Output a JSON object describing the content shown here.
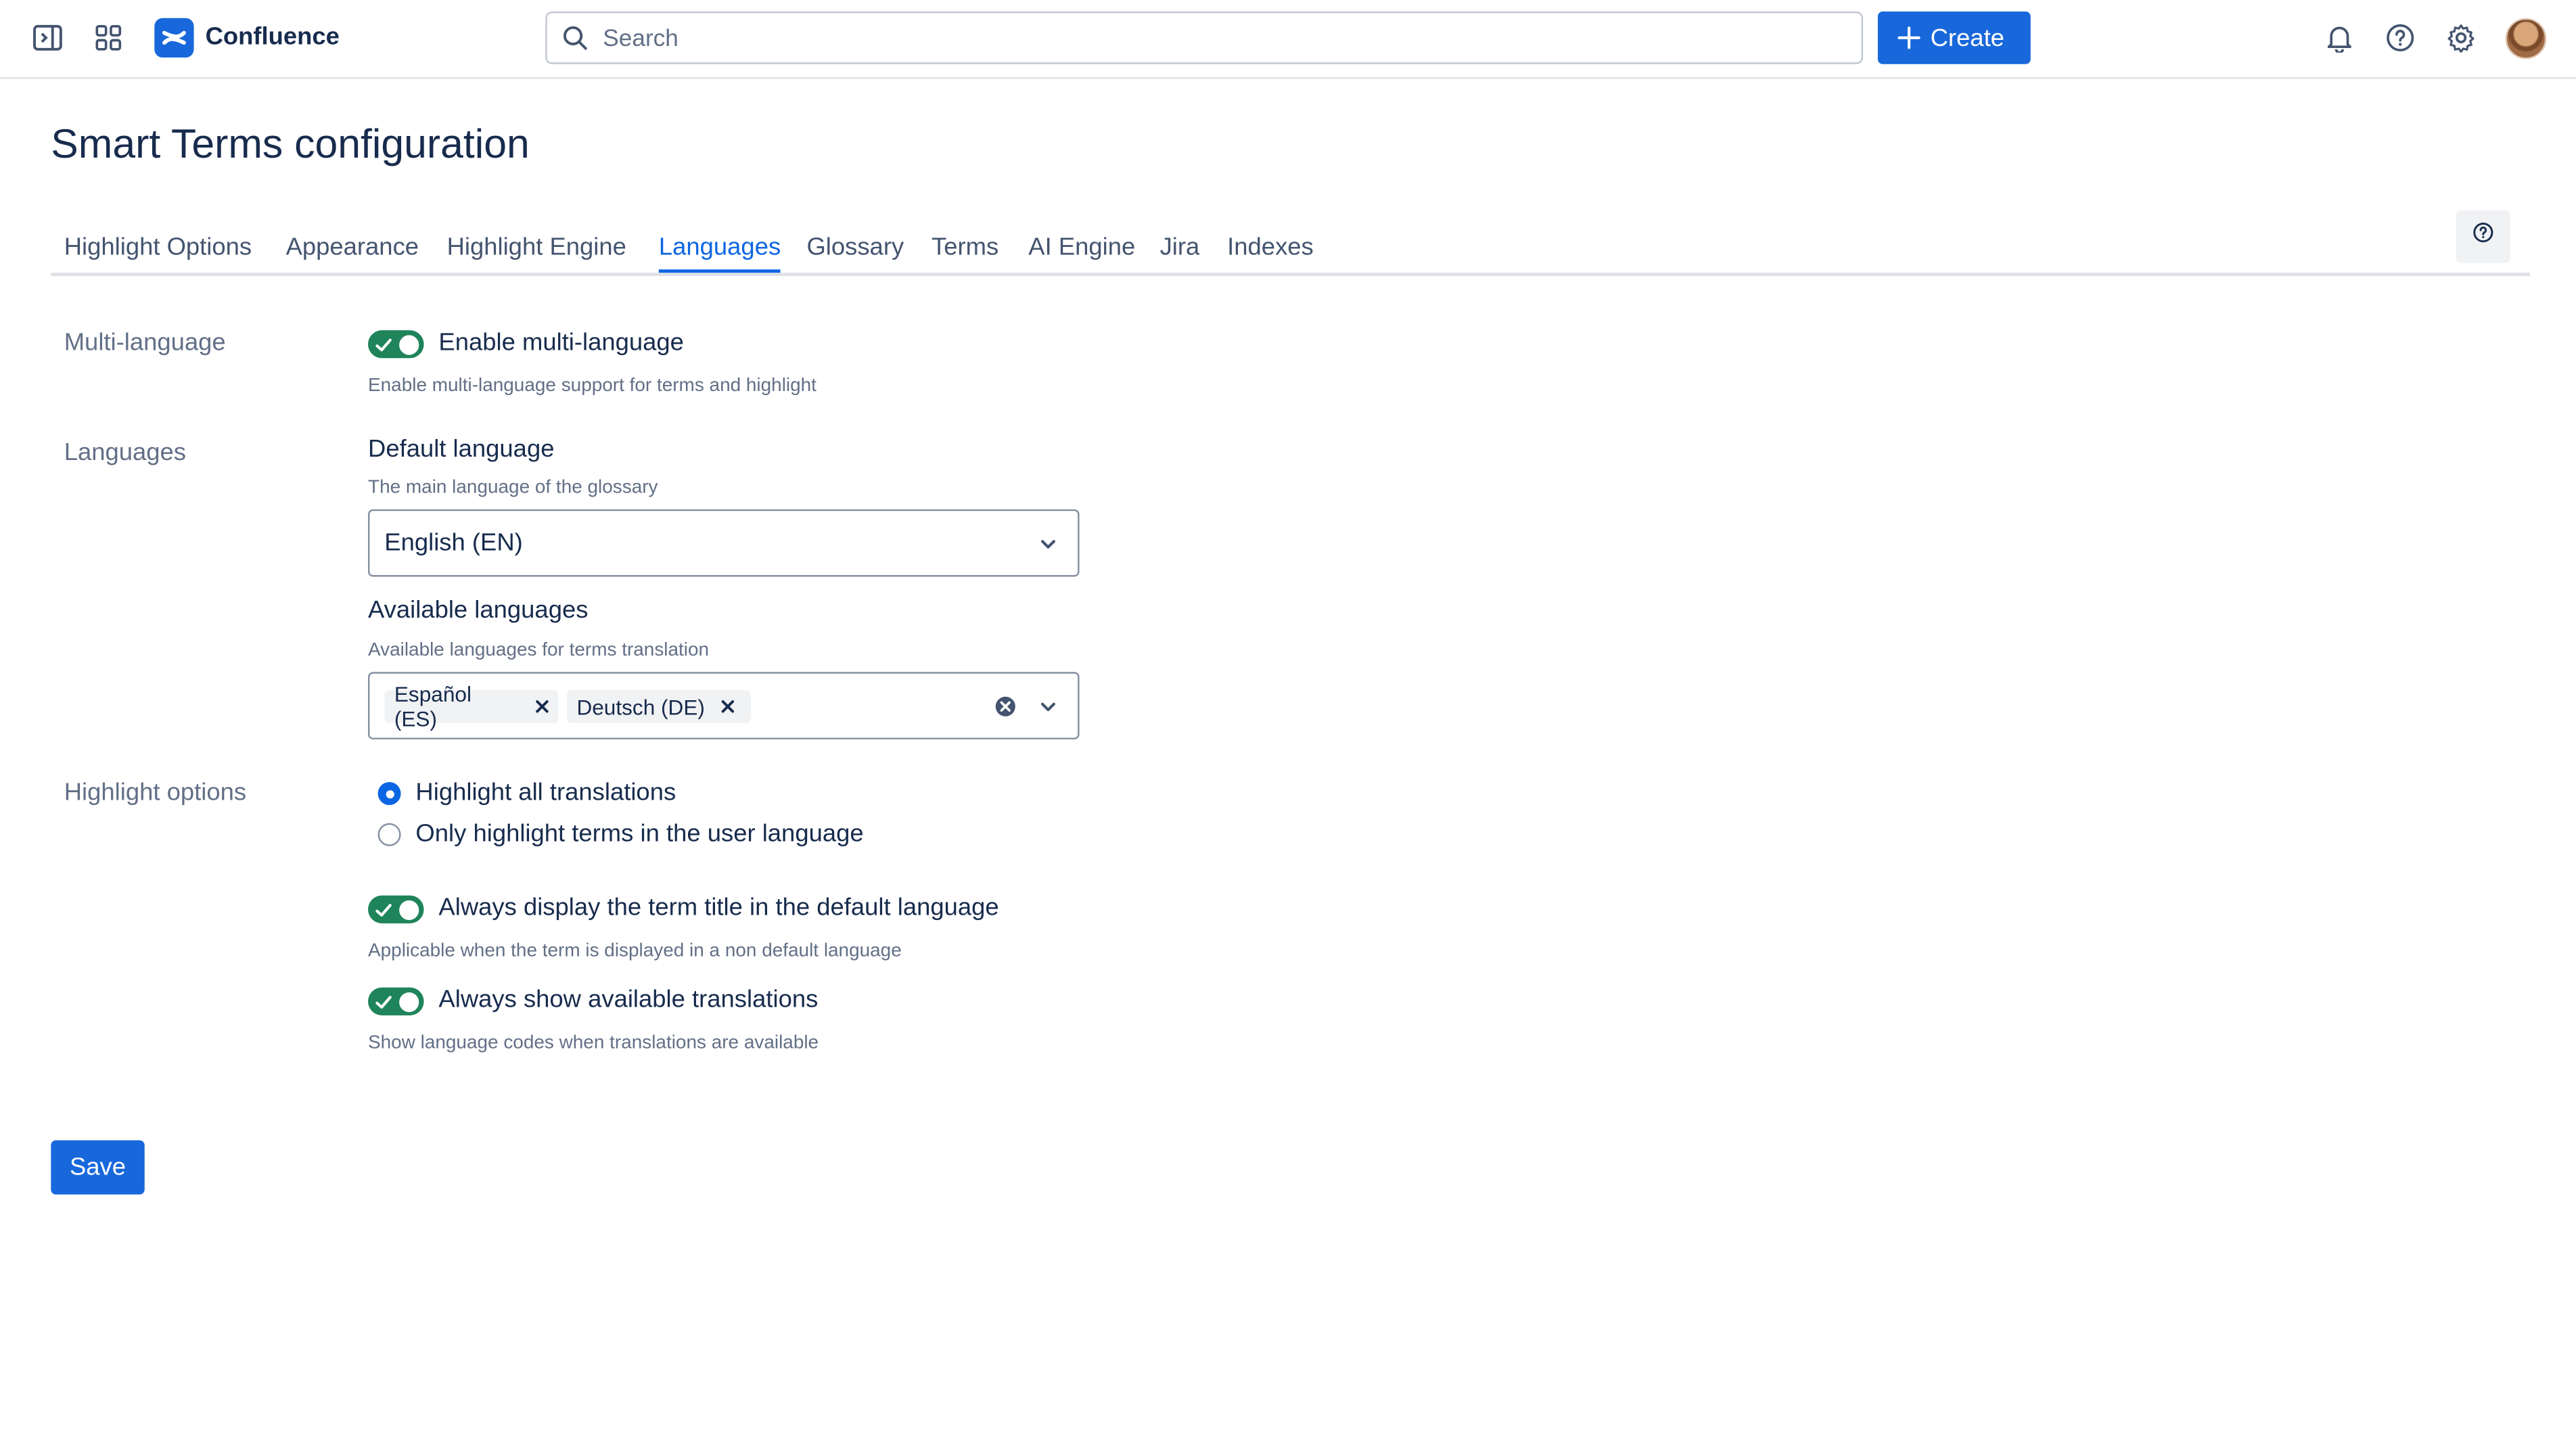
{
  "topbar": {
    "app_name": "Confluence",
    "search_placeholder": "Search",
    "create_label": "Create",
    "icons": [
      "sidebar-toggle-icon",
      "app-switcher-icon",
      "confluence-logo-icon",
      "search-icon",
      "plus-icon",
      "notifications-bell-icon",
      "help-icon",
      "settings-gear-icon",
      "user-avatar"
    ]
  },
  "page": {
    "title": "Smart Terms configuration"
  },
  "tabs": [
    {
      "label": "Highlight Options",
      "active": false
    },
    {
      "label": "Appearance",
      "active": false
    },
    {
      "label": "Highlight Engine",
      "active": false
    },
    {
      "label": "Languages",
      "active": true
    },
    {
      "label": "Glossary",
      "active": false
    },
    {
      "label": "Terms",
      "active": false
    },
    {
      "label": "AI Engine",
      "active": false
    },
    {
      "label": "Jira",
      "active": false
    },
    {
      "label": "Indexes",
      "active": false
    }
  ],
  "multi_language": {
    "section_label": "Multi-language",
    "toggle_label": "Enable multi-language",
    "toggle_on": true,
    "helper": "Enable multi-language support for terms and highlight"
  },
  "languages": {
    "section_label": "Languages",
    "default_label": "Default language",
    "default_helper": "The main language of the glossary",
    "default_value": "English (EN)",
    "available_label": "Available languages",
    "available_helper": "Available languages for terms translation",
    "available_values": [
      "Español (ES)",
      "Deutsch (DE)"
    ]
  },
  "highlight_options": {
    "section_label": "Highlight options",
    "radio_all": "Highlight all translations",
    "radio_user": "Only highlight terms in the user language",
    "selected": "all",
    "toggle_title_label": "Always display the term title in the default language",
    "toggle_title_helper": "Applicable when the term is displayed in a non default language",
    "toggle_title_on": true,
    "toggle_translations_label": "Always show available translations",
    "toggle_translations_helper": "Show language codes when translations are available",
    "toggle_translations_on": true
  },
  "actions": {
    "save_label": "Save"
  },
  "colors": {
    "brand_blue": "#1868db",
    "active_tab": "#0c66e4",
    "toggle_on": "#1f845a"
  }
}
